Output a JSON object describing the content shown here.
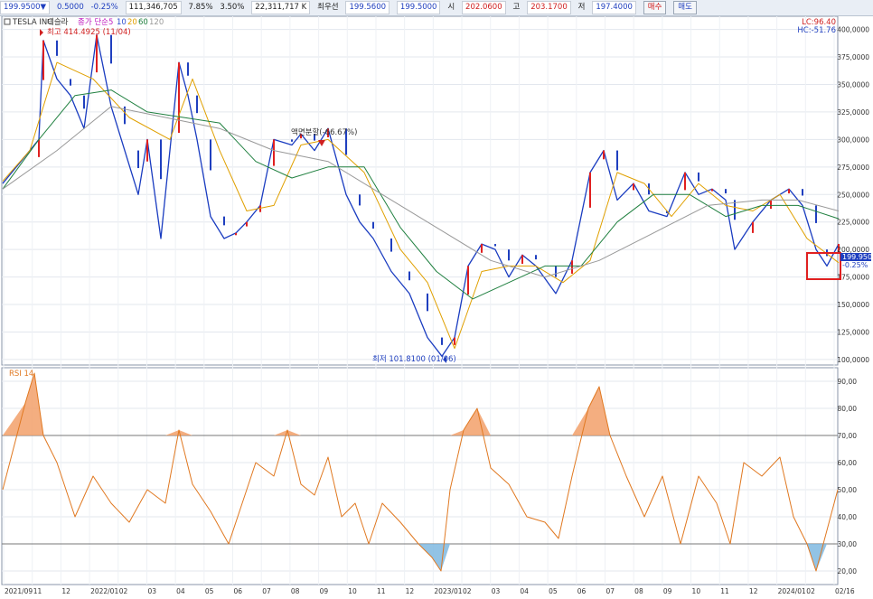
{
  "toolbar": {
    "price": "199.9500▼",
    "change": "0.5000",
    "change_pct": "-0.25%",
    "volume": "111,346,705",
    "turnover_pct": "7.85%",
    "vol_ratio": "3.50%",
    "amount": "22,311,717 K",
    "bid_label": "최우선",
    "bid1": "199.5600",
    "bid2": "199.5000",
    "open_label": "시",
    "open": "202.0600",
    "high_label": "고",
    "high": "203.1700",
    "low_label": "저",
    "low": "197.4000",
    "buy_button": "매수",
    "sell_button": "매도"
  },
  "legend": {
    "symbol": "TESLA INC",
    "name_kr": "테슬라",
    "ma_title": "종가 단순",
    "ma_periods": [
      "5",
      "10",
      "20",
      "60",
      "120"
    ],
    "ma_colors": [
      "#c020c0",
      "#3050d0",
      "#e0a000",
      "#208040",
      "#999999"
    ],
    "lc": "LC:96.40",
    "hc": "HC:-51.76",
    "rsi_title": "RSI 14"
  },
  "annotations": {
    "high_label": "최고 414.4925 (11/04)",
    "low_label": "최저 101.8100 (01/06)",
    "split_label": "액면분할(-66.67%)",
    "last_price": "199.9500",
    "last_pct": "-0.25%"
  },
  "chart_data": {
    "type": "line",
    "title": "TESLA INC",
    "price_axis": {
      "ylim": [
        95,
        412
      ],
      "ticks": [
        "100,0000",
        "125,0000",
        "150,0000",
        "175,0000",
        "200,0000",
        "225,0000",
        "250,0000",
        "275,0000",
        "300,0000",
        "325,0000",
        "350,0000",
        "375,0000",
        "400,0000"
      ]
    },
    "rsi_axis": {
      "ylim": [
        15,
        95
      ],
      "ticks": [
        "20,00",
        "30,00",
        "40,00",
        "50,00",
        "60,00",
        "70,00",
        "80,00",
        "90,00"
      ],
      "overbought": 70,
      "oversold": 30
    },
    "x_labels": [
      "2021/09",
      "11",
      "12",
      "2022/01",
      "02",
      "03",
      "04",
      "05",
      "06",
      "07",
      "08",
      "09",
      "10",
      "11",
      "12",
      "2023/01",
      "02",
      "03",
      "04",
      "05",
      "06",
      "07",
      "08",
      "09",
      "10",
      "11",
      "12",
      "2024/01",
      "02",
      "02/16"
    ],
    "series": [
      {
        "key": "close",
        "color": "#1a3cc0",
        "x": [
          0,
          40,
          45,
          60,
          75,
          90,
          104,
          120,
          135,
          150,
          160,
          175,
          195,
          205,
          215,
          230,
          245,
          258,
          270,
          285,
          300,
          320,
          330,
          345,
          360,
          380,
          395,
          410,
          430,
          450,
          470,
          486,
          500,
          515,
          530,
          545,
          560,
          575,
          590,
          612,
          630,
          650,
          665,
          680,
          698,
          715,
          735,
          755,
          770,
          785,
          800,
          810,
          830,
          850,
          870,
          885,
          900,
          912,
          925
        ],
        "y": [
          260,
          300,
          390,
          355,
          340,
          310,
          395,
          330,
          290,
          250,
          300,
          210,
          370,
          340,
          300,
          230,
          210,
          215,
          225,
          240,
          300,
          295,
          305,
          290,
          310,
          250,
          225,
          210,
          180,
          160,
          120,
          103,
          120,
          185,
          205,
          200,
          175,
          195,
          185,
          160,
          190,
          270,
          290,
          245,
          260,
          235,
          230,
          270,
          250,
          255,
          245,
          200,
          225,
          245,
          255,
          240,
          200,
          185,
          205
        ]
      },
      {
        "key": "ma20",
        "color": "#e0a000",
        "x": [
          0,
          30,
          60,
          100,
          140,
          185,
          210,
          240,
          270,
          300,
          330,
          360,
          400,
          440,
          470,
          500,
          530,
          560,
          590,
          620,
          650,
          680,
          710,
          740,
          770,
          800,
          830,
          860,
          890,
          925
        ],
        "y": [
          262,
          290,
          370,
          355,
          320,
          300,
          355,
          290,
          235,
          240,
          295,
          300,
          270,
          200,
          170,
          110,
          180,
          185,
          185,
          170,
          190,
          270,
          260,
          230,
          260,
          240,
          235,
          250,
          210,
          188
        ]
      },
      {
        "key": "ma60",
        "color": "#208040",
        "x": [
          0,
          40,
          80,
          120,
          160,
          200,
          240,
          280,
          320,
          360,
          400,
          440,
          480,
          520,
          560,
          600,
          640,
          680,
          720,
          760,
          800,
          840,
          880,
          925
        ],
        "y": [
          255,
          300,
          340,
          345,
          325,
          320,
          315,
          280,
          265,
          275,
          275,
          220,
          180,
          155,
          170,
          185,
          185,
          225,
          250,
          250,
          230,
          240,
          240,
          228
        ]
      },
      {
        "key": "ma120",
        "color": "#999999",
        "x": [
          0,
          60,
          120,
          180,
          240,
          300,
          360,
          420,
          480,
          540,
          600,
          660,
          720,
          780,
          840,
          880,
          925
        ],
        "y": [
          255,
          290,
          330,
          320,
          310,
          290,
          280,
          250,
          220,
          190,
          175,
          190,
          215,
          240,
          245,
          245,
          235
        ]
      },
      {
        "key": "rsi",
        "color": "#e07820",
        "x": [
          0,
          25,
          35,
          45,
          60,
          80,
          100,
          120,
          140,
          160,
          180,
          195,
          210,
          230,
          250,
          265,
          280,
          300,
          315,
          330,
          345,
          360,
          375,
          390,
          405,
          420,
          440,
          460,
          475,
          485,
          495,
          510,
          525,
          540,
          560,
          580,
          600,
          615,
          630,
          648,
          660,
          672,
          690,
          710,
          730,
          750,
          770,
          790,
          805,
          820,
          840,
          860,
          875,
          890,
          900,
          912,
          924
        ],
        "y": [
          50,
          82,
          93,
          70,
          60,
          40,
          55,
          45,
          38,
          50,
          45,
          72,
          52,
          42,
          30,
          45,
          60,
          55,
          72,
          52,
          48,
          62,
          40,
          45,
          30,
          45,
          38,
          30,
          25,
          20,
          50,
          72,
          80,
          58,
          52,
          40,
          38,
          32,
          55,
          80,
          88,
          70,
          55,
          40,
          55,
          30,
          55,
          45,
          30,
          60,
          55,
          62,
          40,
          30,
          20,
          35,
          50
        ]
      }
    ]
  }
}
